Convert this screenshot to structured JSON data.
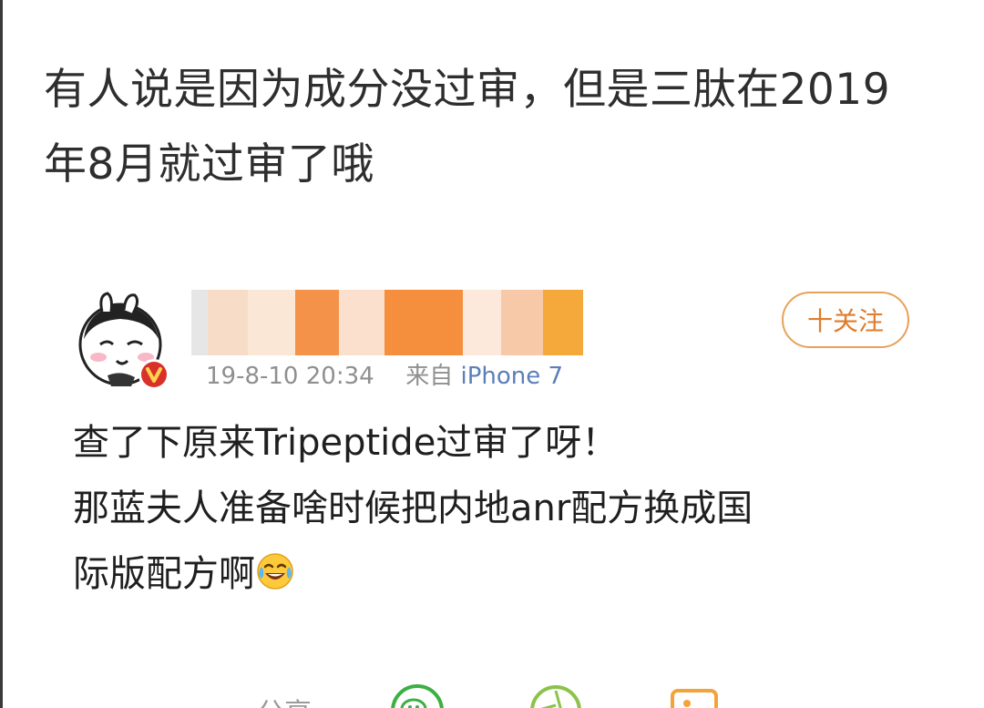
{
  "caption": {
    "line1": "有人说是因为成分没过审，但是三肽在2019",
    "line2": "年8月就过审了哦"
  },
  "post": {
    "timestamp": "19-8-10 20:34",
    "source_prefix": "来自",
    "source": "iPhone 7",
    "follow_label": "十关注",
    "text_lines": [
      "查了下原来Tripeptide过审了呀！",
      "那蓝夫人准备啥时候把内地anr配方换成国",
      "际版配方啊"
    ],
    "emoji": "laughing-tears-emoji"
  },
  "actions": {
    "share_label": "分享",
    "icons": [
      "wechat-icon",
      "moments-icon",
      "save-image-icon"
    ]
  },
  "colors": {
    "accent": "#e07c2c",
    "link": "#5b7fb8",
    "verified": "#d9302a",
    "wechat": "#3cb043",
    "moments": "#8bc34a",
    "image": "#f2a33a"
  }
}
